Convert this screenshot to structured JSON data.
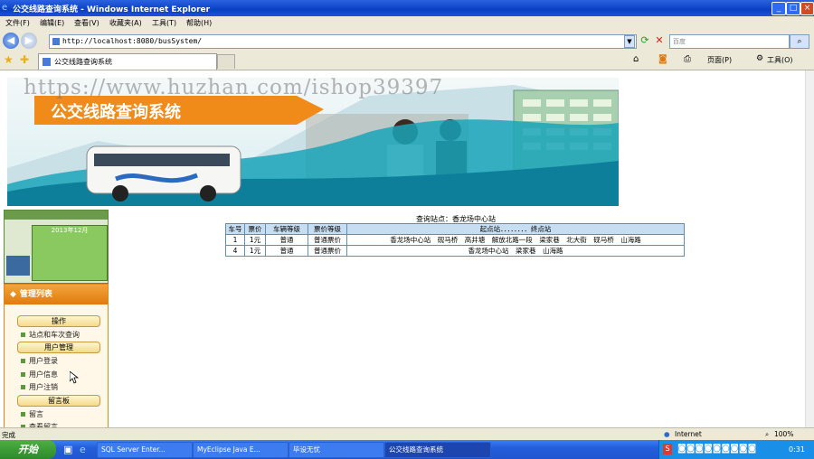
{
  "window": {
    "title": "公交线路查询系统 - Windows Internet Explorer"
  },
  "menu": [
    "文件(F)",
    "编辑(E)",
    "查看(V)",
    "收藏夹(A)",
    "工具(T)",
    "帮助(H)"
  ],
  "address": {
    "url": "http://localhost:8080/busSystem/"
  },
  "search": {
    "placeholder": "百度"
  },
  "tab": {
    "title": "公交线路查询系统"
  },
  "toolbar": {
    "page_label": "页面(P)",
    "tools_label": "工具(O)"
  },
  "banner": {
    "title": "公交线路查询系统",
    "watermark": "https://www.huzhan.com/ishop39397"
  },
  "calendar": {
    "header": "2013年12月"
  },
  "sidebar": {
    "header": "管理列表",
    "sections": [
      {
        "label": "操作",
        "items": [
          "站点和车次查询"
        ]
      },
      {
        "label": "用户管理",
        "items": [
          "用户登录",
          "用户信息",
          "用户注销"
        ]
      },
      {
        "label": "留言板",
        "items": [
          "留言",
          "查看留言"
        ]
      }
    ]
  },
  "query": {
    "title": "查询站点：香龙场中心站",
    "headers": [
      "车号",
      "票价",
      "车辆等级",
      "票价等级",
      "起点站．．．．．．．．终点站"
    ],
    "rows": [
      [
        "1",
        "1元",
        "普通",
        "普通票价",
        "香龙场中心站　砚马桥　高井塘　解放北路一段　梁家巷　北大街　砚马桥　山海路"
      ],
      [
        "4",
        "1元",
        "普通",
        "普通票价",
        "香龙场中心站　梁家巷　山海路"
      ]
    ]
  },
  "status": {
    "left": "完成",
    "zone": "Internet",
    "zoom": "100%"
  },
  "taskbar": {
    "start": "开始",
    "tasks": [
      "SQL Server Enter...",
      "MyEclipse Java E...",
      "毕设无忧",
      "公交线路查询系统"
    ],
    "clock": "0:31"
  },
  "colors": {
    "titlebar": "#0a3fc4",
    "accent_orange": "#e07a10",
    "table_header": "#c7def2",
    "banner_teal": "#1aa5b8"
  }
}
